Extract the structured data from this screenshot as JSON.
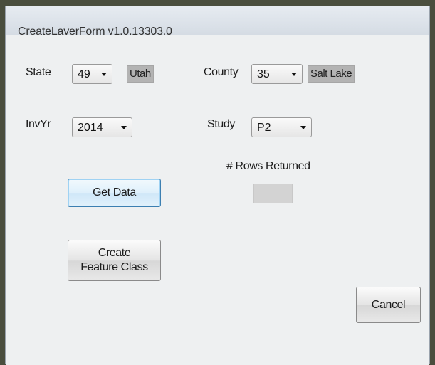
{
  "window": {
    "title": "CreateLayerForm  v1.0.13303.0"
  },
  "state": {
    "label": "State",
    "value": "49",
    "name": "Utah"
  },
  "county": {
    "label": "County",
    "value": "35",
    "name": "Salt Lake"
  },
  "invyr": {
    "label": "InvYr",
    "value": "2014"
  },
  "study": {
    "label": "Study",
    "value": "P2"
  },
  "rows": {
    "label": "# Rows Returned",
    "value": ""
  },
  "buttons": {
    "get_data": "Get Data",
    "create_line1": "Create",
    "create_line2": "Feature Class",
    "cancel": "Cancel"
  }
}
